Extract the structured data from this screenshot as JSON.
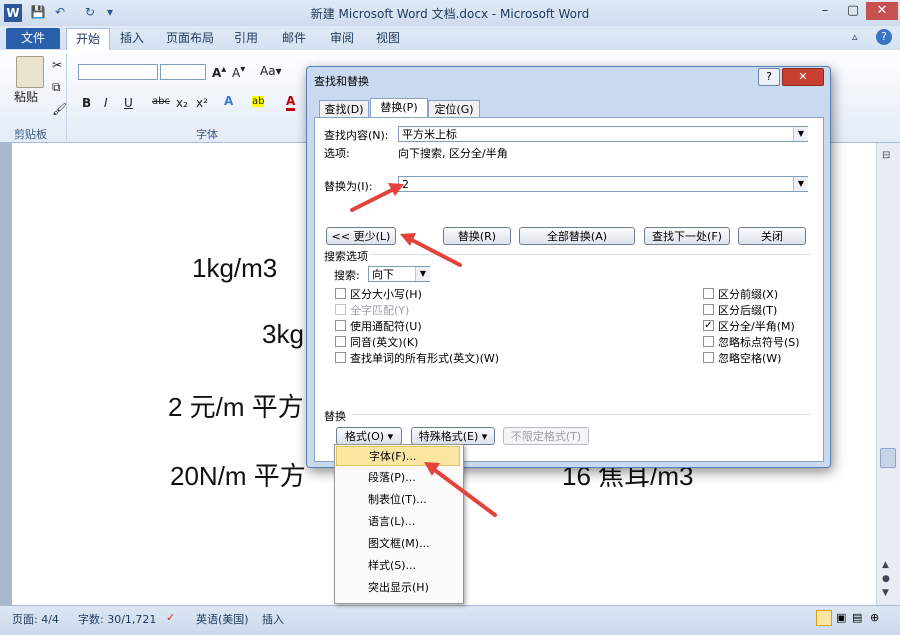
{
  "window": {
    "title": "新建 Microsoft Word 文档.docx - Microsoft Word",
    "app_icon": "W"
  },
  "ribbon": {
    "tabs": [
      "文件",
      "开始",
      "插入",
      "页面布局",
      "引用",
      "邮件",
      "审阅",
      "视图"
    ],
    "active_tab": "开始",
    "clipboard_group": "剪贴板",
    "paste_label": "粘贴",
    "font_group": "字体"
  },
  "document": {
    "lines": [
      "1kg/m3",
      "3kg",
      "2 元/m 平方",
      "20N/m 平方",
      "16 焦耳/m3"
    ]
  },
  "dialog": {
    "title": "查找和替换",
    "help": "?",
    "close": "✕",
    "tabs": [
      "查找(D)",
      "替换(P)",
      "定位(G)"
    ],
    "active_tab": "替换(P)",
    "find_label": "查找内容(N):",
    "find_value": "平方米上标",
    "options_label": "选项:",
    "options_value": "向下搜索, 区分全/半角",
    "replace_label": "替换为(I):",
    "replace_value": "2",
    "buttons": {
      "less": "<< 更少(L)",
      "replace": "替换(R)",
      "replace_all": "全部替换(A)",
      "find_next": "查找下一处(F)",
      "close": "关闭"
    },
    "search_options_title": "搜索选项",
    "search_label": "搜索:",
    "search_value": "向下",
    "left_options": [
      {
        "label": "区分大小写(H)",
        "checked": false,
        "disabled": false
      },
      {
        "label": "全字匹配(Y)",
        "checked": false,
        "disabled": true
      },
      {
        "label": "使用通配符(U)",
        "checked": false,
        "disabled": false
      },
      {
        "label": "同音(英文)(K)",
        "checked": false,
        "disabled": false
      },
      {
        "label": "查找单词的所有形式(英文)(W)",
        "checked": false,
        "disabled": false
      }
    ],
    "right_options": [
      {
        "label": "区分前缀(X)",
        "checked": false
      },
      {
        "label": "区分后缀(T)",
        "checked": false
      },
      {
        "label": "区分全/半角(M)",
        "checked": true
      },
      {
        "label": "忽略标点符号(S)",
        "checked": false
      },
      {
        "label": "忽略空格(W)",
        "checked": false
      }
    ],
    "replace_section": "替换",
    "format_button": "格式(O) ▾",
    "special_button": "特殊格式(E) ▾",
    "no_format_button": "不限定格式(T)"
  },
  "format_menu": {
    "items": [
      "字体(F)...",
      "段落(P)...",
      "制表位(T)...",
      "语言(L)...",
      "图文框(M)...",
      "样式(S)...",
      "突出显示(H)"
    ]
  },
  "statusbar": {
    "page": "页面: 4/4",
    "words": "字数: 30/1,721",
    "language": "英语(美国)",
    "mode": "插入"
  },
  "colors": {
    "accent": "#2a5fac",
    "annotation_arrow": "#e2433b",
    "menu_highlight": "#fbe7a2"
  }
}
